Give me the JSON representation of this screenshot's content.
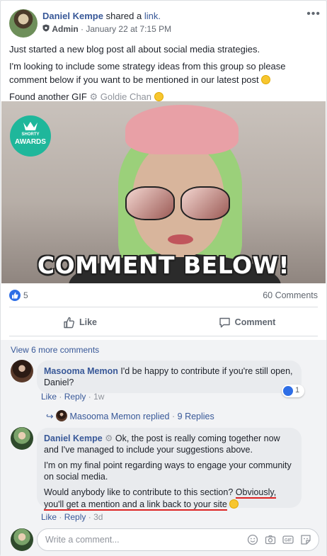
{
  "post": {
    "author": "Daniel Kempe",
    "action": "shared a",
    "action_link": "link.",
    "role": "Admin",
    "timestamp": "January 22 at 7:15 PM",
    "paragraph1": "Just started a new blog post all about social media strategies.",
    "paragraph2": "I'm looking to include some strategy ideas from this group so please comment below if you want to be mentioned in our latest post",
    "gif_prefix": "Found another GIF",
    "gif_author": "Goldie Chan",
    "gif_caption": "COMMENT BELOW!",
    "gif_badge_top": "SHORTY",
    "gif_badge_bottom": "AWARDS"
  },
  "stats": {
    "like_count": "5",
    "comment_count": "60 Comments"
  },
  "actions": {
    "like_label": "Like",
    "comment_label": "Comment"
  },
  "comments": {
    "view_more": "View 6 more comments",
    "c1": {
      "author": "Masooma Memon",
      "text": "I'd be happy to contribute if you're still open, Daniel?",
      "like_label": "Like",
      "reply_label": "Reply",
      "time": "1w",
      "reaction_count": "1",
      "replied_name": "Masooma Memon",
      "replied_text": "replied",
      "replies": "9 Replies"
    },
    "c2": {
      "author": "Daniel Kempe",
      "text1": "Ok, the post is really coming together now and I've managed to include your suggestions above.",
      "text2": "I'm on my final point regarding ways to engage your community on social media.",
      "text3_plain": "Would anybody like to contribute to this section?",
      "text3_underlined": "Obviously, you'll get a mention and a link back to your site",
      "like_label": "Like",
      "reply_label": "Reply",
      "time": "3d"
    },
    "write_placeholder": "Write a comment..."
  },
  "colors": {
    "link": "#385898",
    "like_blue": "#2e6ee6",
    "underline": "#dd2222"
  }
}
